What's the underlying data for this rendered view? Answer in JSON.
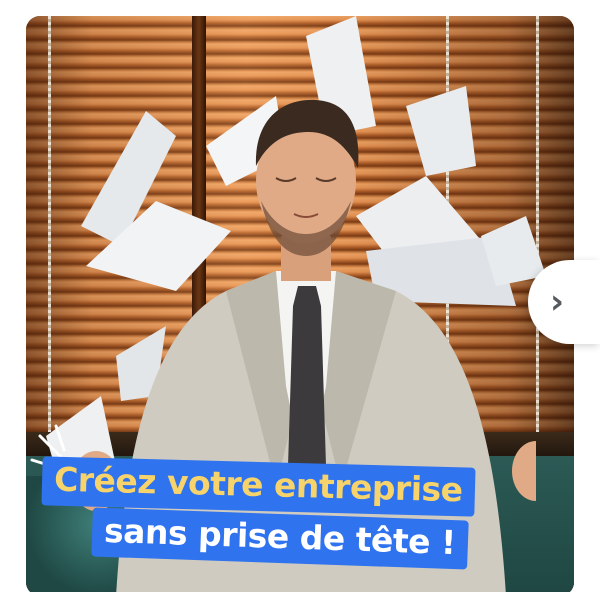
{
  "carousel": {
    "caption": {
      "line1": "Créez votre entreprise",
      "line2": "sans prise de tête !"
    },
    "next_button": {
      "glyph": "›",
      "icon": "chevron-right-icon"
    }
  },
  "colors": {
    "caption_background": "#2f73ee",
    "caption_line1_text": "#f6d36b",
    "caption_line2_text": "#ffffff",
    "chevron": "#555a60"
  }
}
